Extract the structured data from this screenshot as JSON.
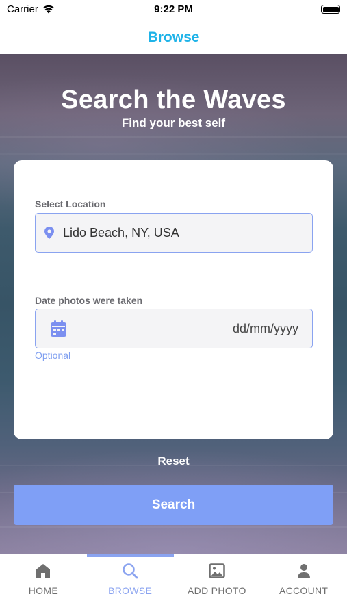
{
  "status_bar": {
    "carrier": "Carrier",
    "time": "9:22 PM"
  },
  "nav": {
    "title": "Browse"
  },
  "hero": {
    "title": "Search the Waves",
    "subtitle": "Find your best self"
  },
  "form": {
    "location": {
      "label": "Select Location",
      "value": "Lido Beach, NY, USA"
    },
    "date": {
      "label": "Date photos were taken",
      "placeholder": "dd/mm/yyyy",
      "hint": "Optional"
    }
  },
  "actions": {
    "reset_label": "Reset",
    "search_label": "Search"
  },
  "tabs": [
    {
      "label": "HOME",
      "icon": "home-icon",
      "active": false
    },
    {
      "label": "BROWSE",
      "icon": "search-icon",
      "active": true
    },
    {
      "label": "ADD PHOTO",
      "icon": "image-icon",
      "active": false
    },
    {
      "label": "ACCOUNT",
      "icon": "person-icon",
      "active": false
    }
  ],
  "colors": {
    "nav_title": "#1fb3e8",
    "accent": "#8aa3f0",
    "search_button": "#7f9ff6",
    "tab_inactive": "#6f6f6f"
  }
}
